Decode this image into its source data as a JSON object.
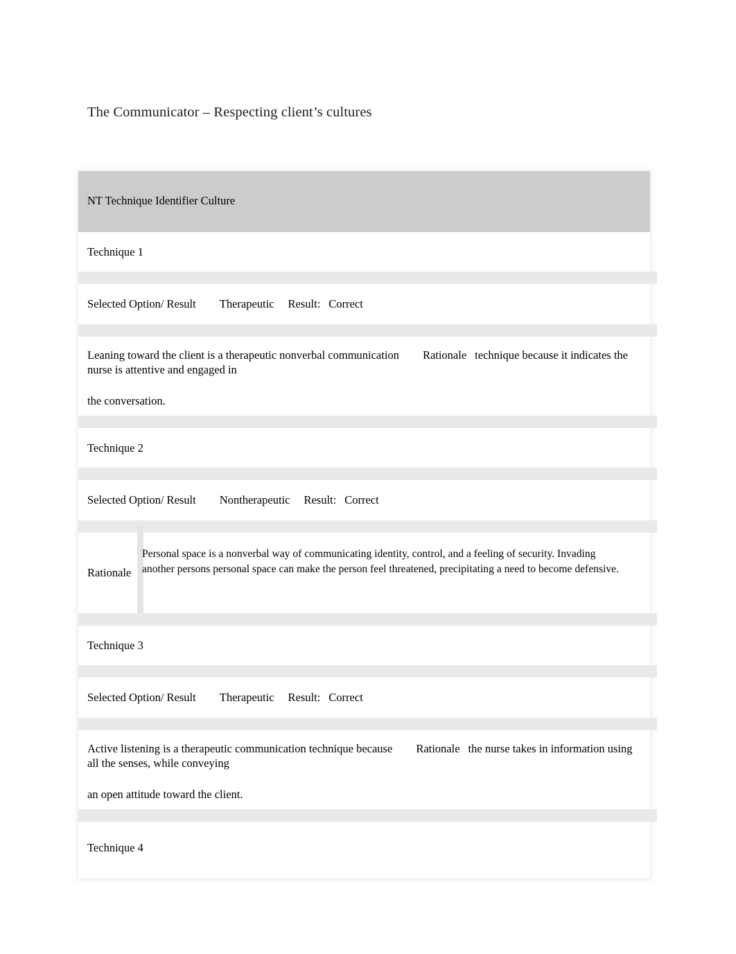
{
  "document": {
    "title": "The Communicator – Respecting client’s cultures"
  },
  "table": {
    "header": {
      "label": "NT Technique Identifier Culture"
    },
    "rows": [
      {
        "technique_label": "Technique 1",
        "option_label": "Selected Option/ Result",
        "option_value": "Therapeutic",
        "result_label": "Result:",
        "result_value": "Correct",
        "rationale_label": "Rationale",
        "rationale_style": "inline",
        "rationale_before": "Leaning toward the client is a therapeutic nonverbal communication",
        "rationale_after": "technique because it indicates the nurse is attentive and engaged in",
        "rationale_tail": "the conversation."
      },
      {
        "technique_label": "Technique 2",
        "option_label": "Selected Option/ Result",
        "option_value": "Nontherapeutic",
        "result_label": "Result:",
        "result_value": "Correct",
        "rationale_label": "Rationale",
        "rationale_style": "boxed",
        "rationale_text": "Personal space is a nonverbal way of communicating identity, control, and a feeling of security. Invading another persons personal space can make the person feel threatened, precipitating a need to become defensive."
      },
      {
        "technique_label": "Technique 3",
        "option_label": "Selected Option/ Result",
        "option_value": "Therapeutic",
        "result_label": "Result:",
        "result_value": "Correct",
        "rationale_label": "Rationale",
        "rationale_style": "inline",
        "rationale_before": "Active listening is a therapeutic communication technique because",
        "rationale_after": "the nurse takes in information using all the senses, while conveying",
        "rationale_tail": "an open attitude toward the client."
      },
      {
        "technique_label": "Technique 4"
      }
    ]
  },
  "colors": {
    "header_gray": "#cccccc",
    "separator_gray": "#e9e9e9",
    "page_background": "#ffffff",
    "text": "#000000"
  }
}
